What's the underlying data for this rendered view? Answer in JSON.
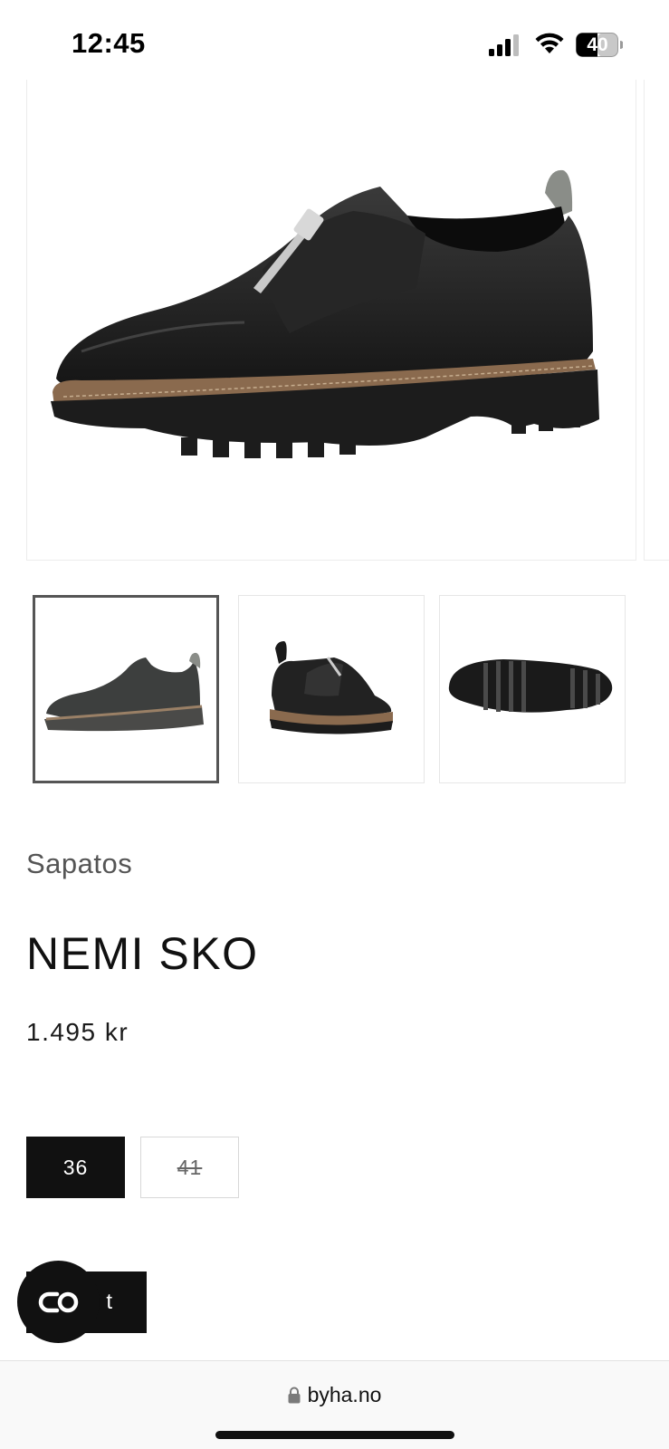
{
  "status_bar": {
    "time": "12:45",
    "battery": "40",
    "icons": [
      "signal-icon",
      "wifi-icon",
      "battery-icon"
    ]
  },
  "gallery": {
    "main_image": "black-zip-shoe-side-view",
    "thumbnails": [
      {
        "image": "shoe-side-view",
        "selected": true
      },
      {
        "image": "shoe-angled-view",
        "selected": false
      },
      {
        "image": "shoe-sole-view",
        "selected": false
      }
    ]
  },
  "product": {
    "category": "Sapatos",
    "title": "NEMI SKO",
    "price": "1.495 kr"
  },
  "sizes": [
    {
      "label": "36",
      "selected": true,
      "available": true
    },
    {
      "label": "41",
      "selected": false,
      "available": false
    }
  ],
  "add_button": {
    "label": "t"
  },
  "chat_button": {
    "icon": "chat-link-icon"
  },
  "browser": {
    "url": "byha.no",
    "icon": "lock-icon"
  },
  "colors": {
    "accent": "#111111",
    "text": "#1a1a1a",
    "muted": "#555555"
  }
}
